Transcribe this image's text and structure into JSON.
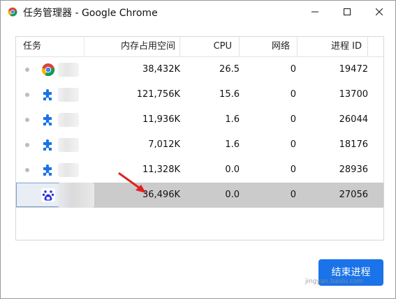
{
  "window": {
    "title": "任务管理器 - Google Chrome"
  },
  "columns": {
    "task": "任务",
    "memory": "内存占用空间",
    "cpu": "CPU",
    "network": "网络",
    "pid": "进程 ID"
  },
  "rows": [
    {
      "icon": "chrome-icon",
      "memory": "38,432K",
      "cpu": "26.5",
      "network": "0",
      "pid": "19472"
    },
    {
      "icon": "extension-puzzle-icon",
      "memory": "121,756K",
      "cpu": "15.6",
      "network": "0",
      "pid": "13700"
    },
    {
      "icon": "extension-puzzle-icon",
      "memory": "11,936K",
      "cpu": "1.6",
      "network": "0",
      "pid": "26044"
    },
    {
      "icon": "extension-puzzle-icon",
      "memory": "7,012K",
      "cpu": "1.6",
      "network": "0",
      "pid": "18176"
    },
    {
      "icon": "extension-puzzle-icon",
      "memory": "11,328K",
      "cpu": "0.0",
      "network": "0",
      "pid": "28936"
    },
    {
      "icon": "baidu-paw-icon",
      "memory": "36,496K",
      "cpu": "0.0",
      "network": "0",
      "pid": "27056",
      "selected": true
    }
  ],
  "actions": {
    "end_process": "结束进程"
  },
  "watermark": "jingyan.baidu.com",
  "colors": {
    "accent": "#1a73e8",
    "selected_row": "#cbcbcb",
    "annotation_arrow": "#e02020"
  }
}
